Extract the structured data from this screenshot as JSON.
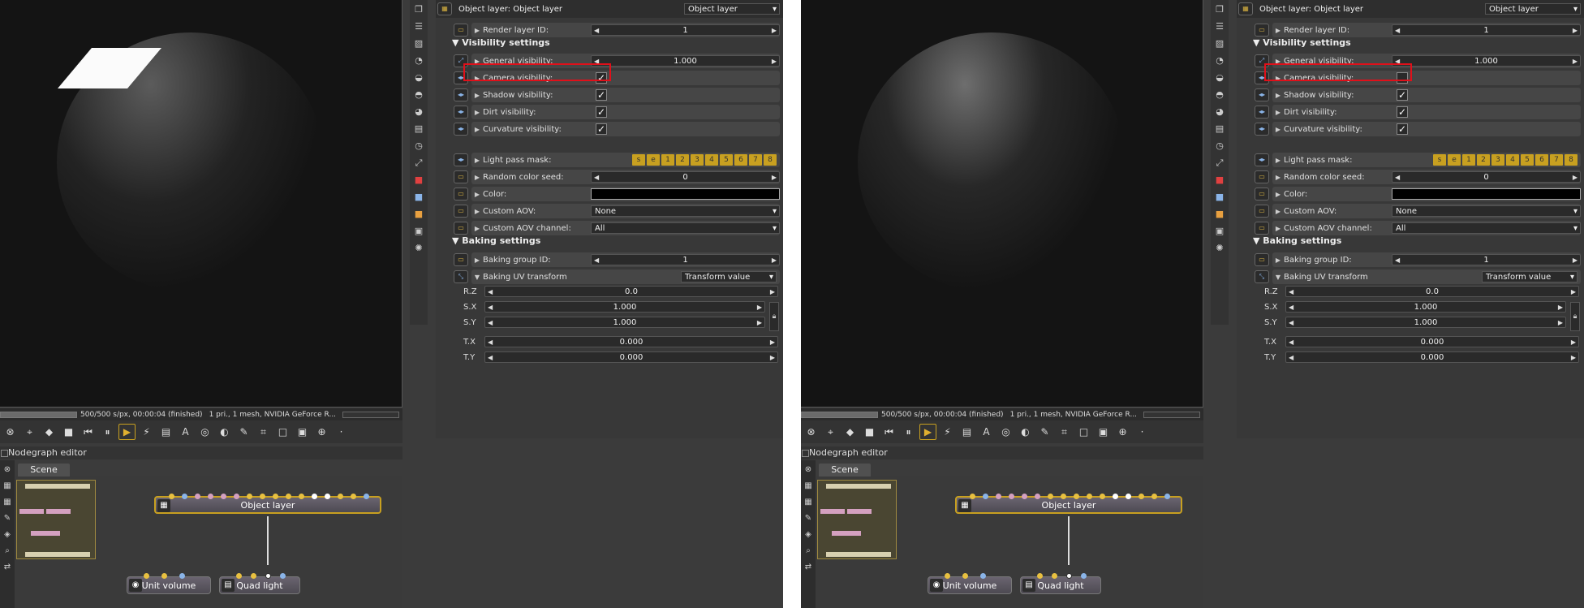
{
  "panes": [
    {
      "id": "left",
      "render_status": "500/500 s/px, 00:00:04 (finished)",
      "render_info": "1 pri., 1 mesh, NVIDIA GeForce R...",
      "camera_visibility_checked": true
    },
    {
      "id": "right",
      "render_status": "500/500 s/px, 00:00:04 (finished)",
      "render_info": "1 pri., 1 mesh, NVIDIA GeForce R...",
      "camera_visibility_checked": false
    }
  ],
  "props": {
    "header_title": "Object layer: Object layer",
    "header_dropdown": "Object layer",
    "render_layer_id_label": "Render layer ID:",
    "render_layer_id_value": "1",
    "visibility_section": "Visibility settings",
    "general_visibility_label": "General visibility:",
    "general_visibility_value": "1.000",
    "camera_visibility_label": "Camera visibility:",
    "shadow_visibility_label": "Shadow visibility:",
    "dirt_visibility_label": "Dirt visibility:",
    "curvature_visibility_label": "Curvature visibility:",
    "light_pass_mask_label": "Light pass mask:",
    "light_pass_buttons": [
      "s",
      "e",
      "1",
      "2",
      "3",
      "4",
      "5",
      "6",
      "7",
      "8"
    ],
    "random_color_seed_label": "Random color seed:",
    "random_color_seed_value": "0",
    "color_label": "Color:",
    "custom_aov_label": "Custom AOV:",
    "custom_aov_value": "None",
    "custom_aov_channel_label": "Custom AOV channel:",
    "custom_aov_channel_value": "All",
    "baking_section": "Baking settings",
    "baking_group_id_label": "Baking group ID:",
    "baking_group_id_value": "1",
    "baking_uv_transform_label": "Baking UV transform",
    "baking_uv_transform_value": "Transform value",
    "rz_label": "R.Z",
    "rz_value": "0.0",
    "sx_label": "S.X",
    "sx_value": "1.000",
    "sy_label": "S.Y",
    "sy_value": "1.000",
    "tx_label": "T.X",
    "tx_value": "0.000",
    "ty_label": "T.Y",
    "ty_value": "0.000"
  },
  "nodegraph": {
    "title": "Nodegraph editor",
    "tab": "Scene",
    "object_layer_node": "Object layer",
    "unit_volume_node": "Unit volume",
    "quad_light_node": "Quad light"
  },
  "colors": {
    "highlight": "#e0101a",
    "accent": "#c8a020"
  }
}
